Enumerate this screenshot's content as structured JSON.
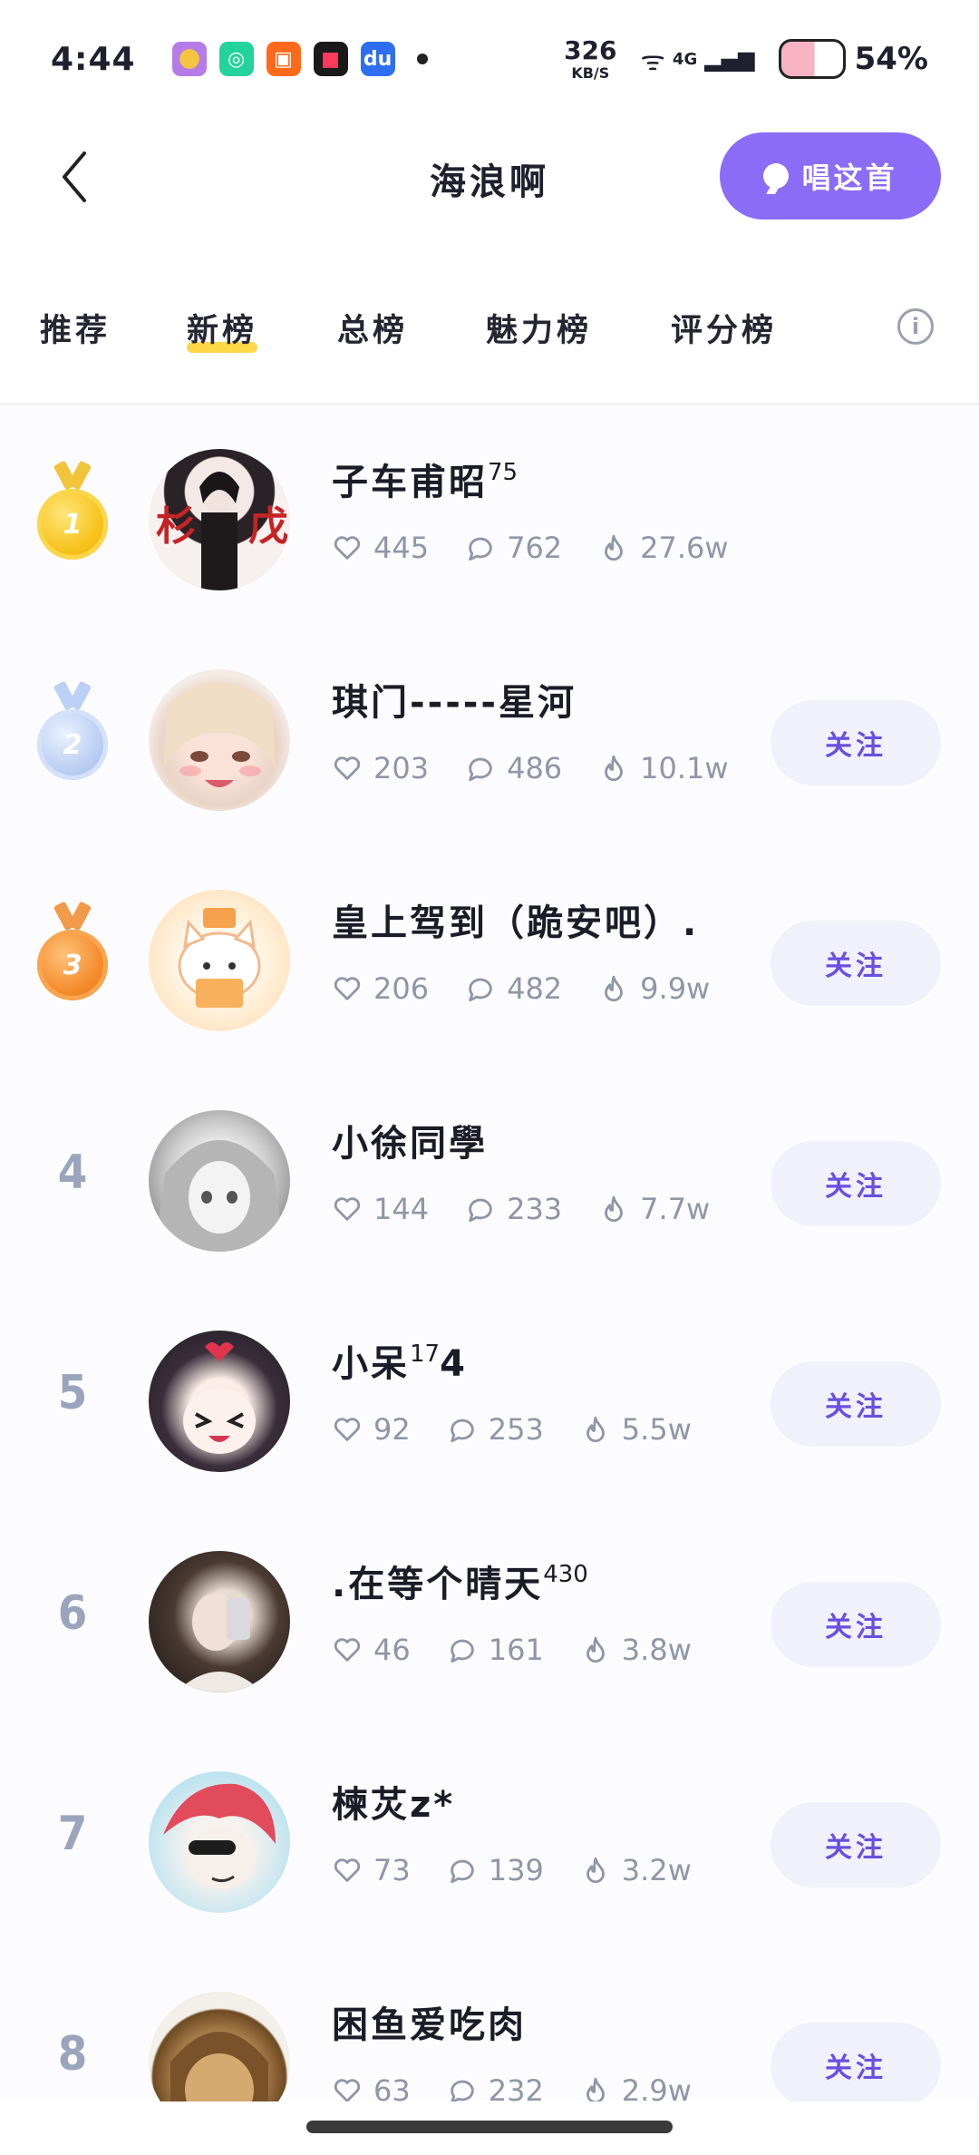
{
  "status_bar": {
    "time": "4:44",
    "speed_value": "326",
    "speed_unit": "KB/S",
    "network": "4G",
    "battery": "54%"
  },
  "header": {
    "title": "海浪啊",
    "sing_button": "唱这首"
  },
  "tabs": [
    "推荐",
    "新榜",
    "总榜",
    "魅力榜",
    "评分榜"
  ],
  "active_tab": "新榜",
  "rows": [
    {
      "rank": "1",
      "name": "子车甫昭",
      "sup": "75",
      "likes": "445",
      "comments": "762",
      "heat": "27.6w",
      "follow": ""
    },
    {
      "rank": "2",
      "name": "琪门-----星河",
      "sup": "",
      "likes": "203",
      "comments": "486",
      "heat": "10.1w",
      "follow": "关注"
    },
    {
      "rank": "3",
      "name": "皇上驾到（跪安吧）.",
      "sup": "",
      "likes": "206",
      "comments": "482",
      "heat": "9.9w",
      "follow": "关注"
    },
    {
      "rank": "4",
      "name": "小徐同學",
      "sup": "",
      "likes": "144",
      "comments": "233",
      "heat": "7.7w",
      "follow": "关注"
    },
    {
      "rank": "5",
      "name": "小呆",
      "sup": "17",
      "suffix": "4",
      "likes": "92",
      "comments": "253",
      "heat": "5.5w",
      "follow": "关注"
    },
    {
      "rank": "6",
      "name": ".在等个晴天",
      "sup": "430",
      "likes": "46",
      "comments": "161",
      "heat": "3.8w",
      "follow": "关注"
    },
    {
      "rank": "7",
      "name": "楝炗z*",
      "sup": "",
      "likes": "73",
      "comments": "139",
      "heat": "3.2w",
      "follow": "关注"
    },
    {
      "rank": "8",
      "name": "困鱼爱吃肉",
      "sup": "",
      "likes": "63",
      "comments": "232",
      "heat": "2.9w",
      "follow": "关注"
    }
  ],
  "colors": {
    "accent": "#8b6cf6",
    "follow_text": "#6a4fe0",
    "follow_bg": "#f1f1fb",
    "tab_underline": "#ffd84a",
    "rank_gray": "#9aa5bd"
  }
}
